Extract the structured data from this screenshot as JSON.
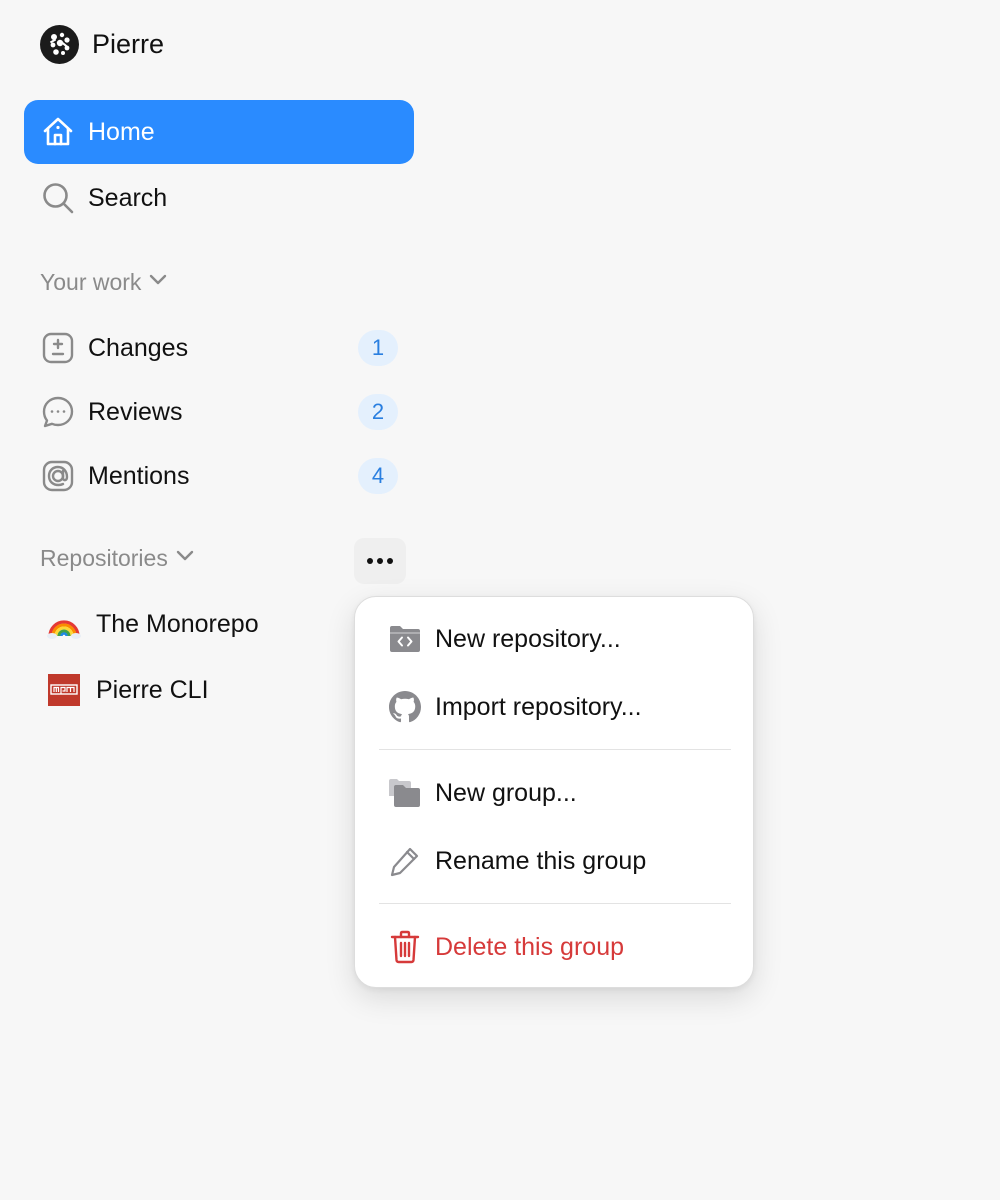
{
  "brand": {
    "name": "Pierre",
    "logo_icon": "pierre-logo-icon"
  },
  "nav": {
    "items": [
      {
        "label": "Home",
        "icon": "home-icon",
        "active": true
      },
      {
        "label": "Search",
        "icon": "search-icon",
        "active": false
      }
    ]
  },
  "your_work": {
    "header": "Your work",
    "items": [
      {
        "label": "Changes",
        "icon": "plus-minus-icon",
        "count": "1"
      },
      {
        "label": "Reviews",
        "icon": "chat-bubble-icon",
        "count": "2"
      },
      {
        "label": "Mentions",
        "icon": "at-sign-icon",
        "count": "4"
      }
    ]
  },
  "repositories": {
    "header": "Repositories",
    "more_label": "•••",
    "items": [
      {
        "label": "The Monorepo",
        "icon": "rainbow-icon"
      },
      {
        "label": "Pierre CLI",
        "icon": "npm-icon"
      }
    ]
  },
  "context_menu": {
    "items": [
      {
        "label": "New repository...",
        "icon": "folder-code-icon"
      },
      {
        "label": "Import repository...",
        "icon": "github-icon"
      },
      {
        "label": "New group...",
        "icon": "folders-icon"
      },
      {
        "label": "Rename this group",
        "icon": "pencil-icon"
      },
      {
        "label": "Delete this group",
        "icon": "trash-icon",
        "danger": true
      }
    ]
  },
  "colors": {
    "accent": "#2a8bff",
    "badge_bg": "#e4f0fd",
    "badge_text": "#2a7fe0",
    "danger": "#d63a3a",
    "background": "#f7f7f7"
  }
}
